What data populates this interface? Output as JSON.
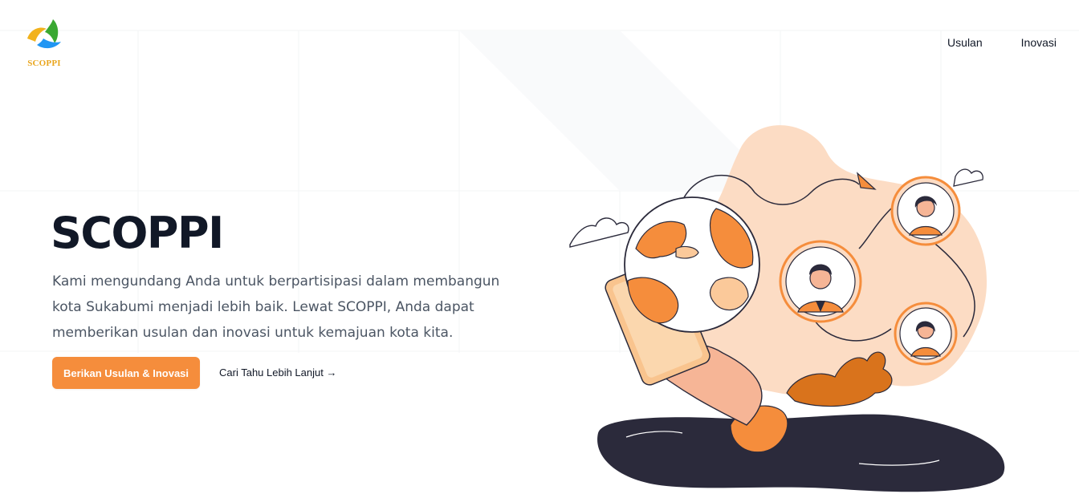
{
  "brand": {
    "name": "SCOPPI",
    "logo_text": "SCOPPI"
  },
  "nav": {
    "items": [
      {
        "label": "Usulan"
      },
      {
        "label": "Inovasi"
      }
    ]
  },
  "hero": {
    "title": "SCOPPI",
    "description": "Kami mengundang Anda untuk berpartisipasi dalam membangun kota Sukabumi menjadi lebih baik. Lewat SCOPPI, Anda dapat memberikan usulan dan inovasi untuk kemajuan kota kita.",
    "primary_button": "Berikan Usulan & Inovasi",
    "secondary_link": "Cari Tahu Lebih Lanjut →"
  },
  "colors": {
    "accent": "#f58d3c",
    "illustration_bg": "#fcdcc4",
    "illustration_dark": "#2b2a3b",
    "logo_yellow": "#f2b21c",
    "logo_green": "#3aa832",
    "logo_blue": "#2196f3"
  },
  "icons": {
    "logo": "scoppi-logo-icon",
    "arrow": "arrow-right-icon"
  }
}
